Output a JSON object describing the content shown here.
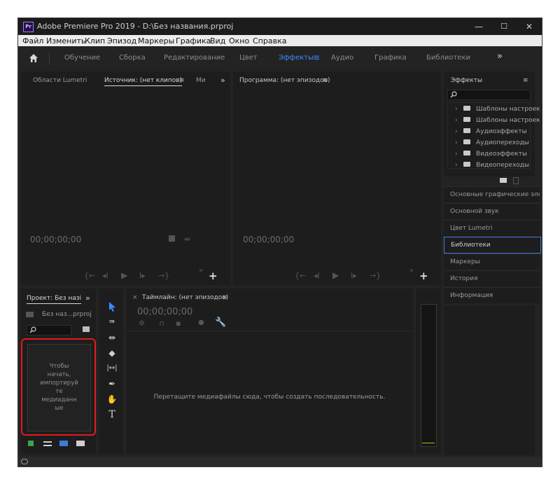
{
  "window": {
    "title": "Adobe Premiere Pro 2019 - D:\\Без названия.prproj",
    "app_icon_text": "Pr",
    "minimize": "—",
    "maximize": "☐",
    "close": "✕"
  },
  "menu": [
    "Файл",
    "Изменить",
    "Клип",
    "Эпизод",
    "Маркеры",
    "Графика",
    "Вид",
    "Окно",
    "Справка"
  ],
  "workspaces": {
    "items": [
      "Обучение",
      "Сборка",
      "Редактирование",
      "Цвет",
      "Эффекты",
      "Аудио",
      "Графика",
      "Библиотеки"
    ],
    "active": "Эффекты",
    "menu_glyph": "≡",
    "more": "»"
  },
  "source_panel": {
    "tabs": [
      "Области Lumetri",
      "Источник: (нет клипов)",
      "Ми"
    ],
    "tab_menu": "≡",
    "more": "»",
    "timecode": "00;00;00;00"
  },
  "program_panel": {
    "tab": "Программа: (нет эпизодов)",
    "tab_menu": "≡",
    "timecode": "00;00;00;00"
  },
  "effects_panel": {
    "tab": "Эффекты",
    "tab_menu": "≡",
    "tree": [
      "Шаблоны настроек",
      "Шаблоны настроек L",
      "Аудиоэффекты",
      "Аудиопереходы",
      "Видеоэффекты",
      "Видеопереходы"
    ]
  },
  "side_panels": [
    "Основные графические эле",
    "Основной звук",
    "Цвет Lumetri",
    "Библиотеки",
    "Маркеры",
    "История",
    "Информация"
  ],
  "side_selected": "Библиотеки",
  "project_panel": {
    "tab": "Проект: Без назі",
    "more": "»",
    "file": "Без наз...prproj",
    "import_hint": [
      "Чтобы",
      "начать,",
      "импортируй",
      "те",
      "медиаданн",
      "ые"
    ]
  },
  "timeline_panel": {
    "close": "×",
    "tab": "Таймлайн: (нет эпизодов)",
    "tab_menu": "≡",
    "timecode": "00;00;00;00",
    "drop_hint": "Перетащите медиафайлы сюда, чтобы создать последовательность."
  },
  "colors": {
    "accent": "#3a8bff",
    "highlight_box": "#e31b1b",
    "panel_bg": "#1d1d1d",
    "frame_bg": "#232323"
  }
}
